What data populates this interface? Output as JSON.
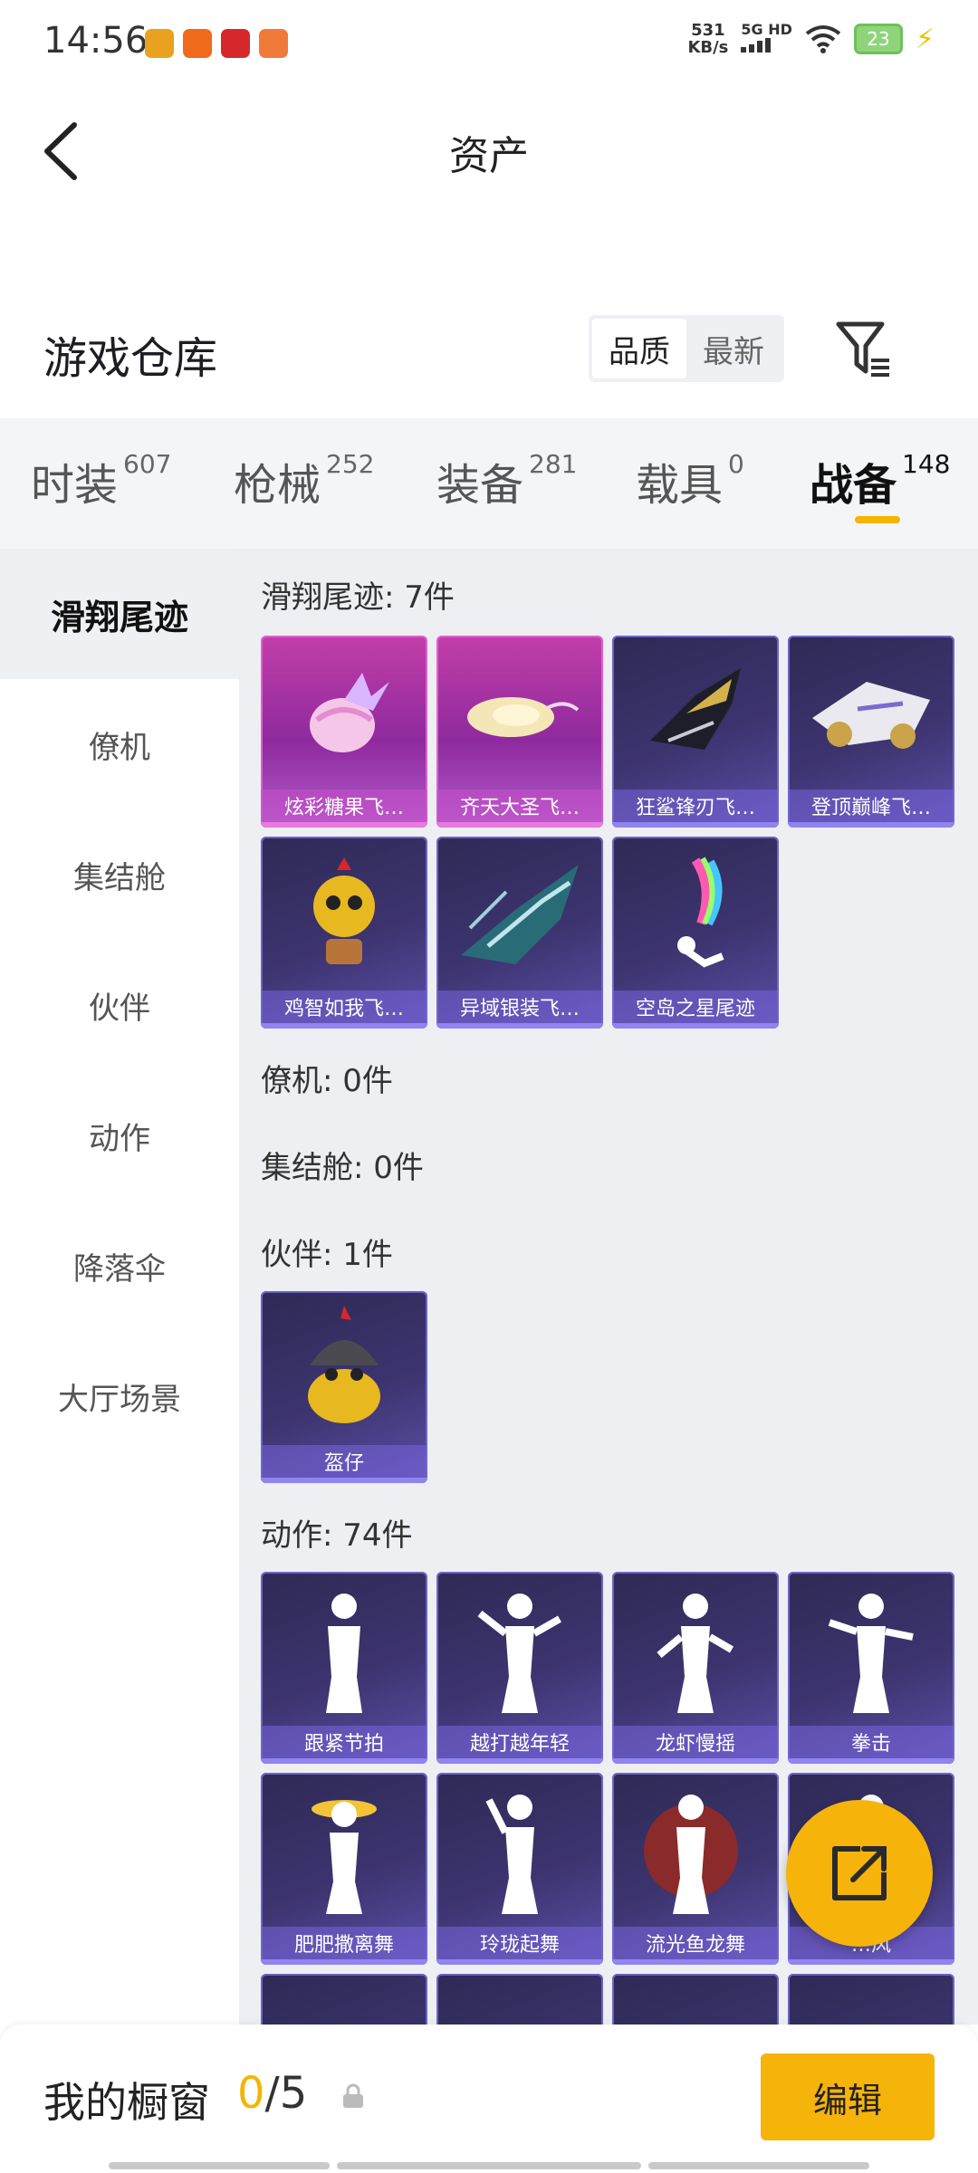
{
  "status_bar": {
    "time": "14:56",
    "speed_value": "531",
    "speed_unit": "KB/s",
    "network": "5G HD",
    "battery": "23"
  },
  "header": {
    "title": "资产"
  },
  "section": {
    "title": "游戏仓库",
    "sort_options": [
      "品质",
      "最新"
    ]
  },
  "tabs": [
    {
      "label": "时装",
      "count": "607"
    },
    {
      "label": "枪械",
      "count": "252"
    },
    {
      "label": "装备",
      "count": "281"
    },
    {
      "label": "载具",
      "count": "0"
    },
    {
      "label": "战备",
      "count": "148"
    }
  ],
  "sidebar": [
    "滑翔尾迹",
    "僚机",
    "集结舱",
    "伙伴",
    "动作",
    "降落伞",
    "大厅场景"
  ],
  "groups": [
    {
      "title": "滑翔尾迹: 7件"
    },
    {
      "title": "僚机: 0件"
    },
    {
      "title": "集结舱: 0件"
    },
    {
      "title": "伙伴: 1件"
    },
    {
      "title": "动作: 74件"
    }
  ],
  "items_glide": [
    "炫彩糖果飞…",
    "齐天大圣飞…",
    "狂鲨锋刃飞…",
    "登顶巅峰飞…",
    "鸡智如我飞…",
    "异域银装飞…",
    "空岛之星尾迹"
  ],
  "items_partner": [
    "盔仔"
  ],
  "items_action": [
    "跟紧节拍",
    "越打越年轻",
    "龙虾慢摇",
    "拳击",
    "肥肥撒离舞",
    "玲珑起舞",
    "流光鱼龙舞",
    "…风"
  ],
  "bottom": {
    "label": "我的橱窗",
    "used": "0",
    "total": "/5",
    "edit": "编辑"
  },
  "colors": {
    "accent": "#f6b30a",
    "card": "#3d3470",
    "card_pink": "#b03aa8"
  }
}
